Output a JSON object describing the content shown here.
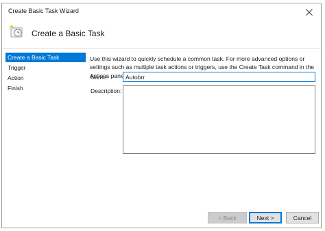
{
  "window": {
    "title": "Create Basic Task Wizard",
    "close_glyph": "✕"
  },
  "header": {
    "title": "Create a Basic Task",
    "icon": "task-scheduler-wizard-icon"
  },
  "nav": {
    "items": [
      {
        "label": "Create a Basic Task",
        "active": true
      },
      {
        "label": "Trigger",
        "active": false
      },
      {
        "label": "Action",
        "active": false
      },
      {
        "label": "Finish",
        "active": false
      }
    ]
  },
  "form": {
    "instructions": "Use this wizard to quickly schedule a common task.  For more advanced options or settings such as multiple task actions or triggers, use the Create Task command in the Actions pane.",
    "name_label": "Name:",
    "name_value": "Autobrr",
    "description_label": "Description:",
    "description_value": ""
  },
  "buttons": {
    "back": "< Back",
    "next": "Next >",
    "cancel": "Cancel"
  },
  "colors": {
    "accent": "#0078d7",
    "nav_active_text": "#ffffff",
    "disabled_button": "#cccccc"
  }
}
